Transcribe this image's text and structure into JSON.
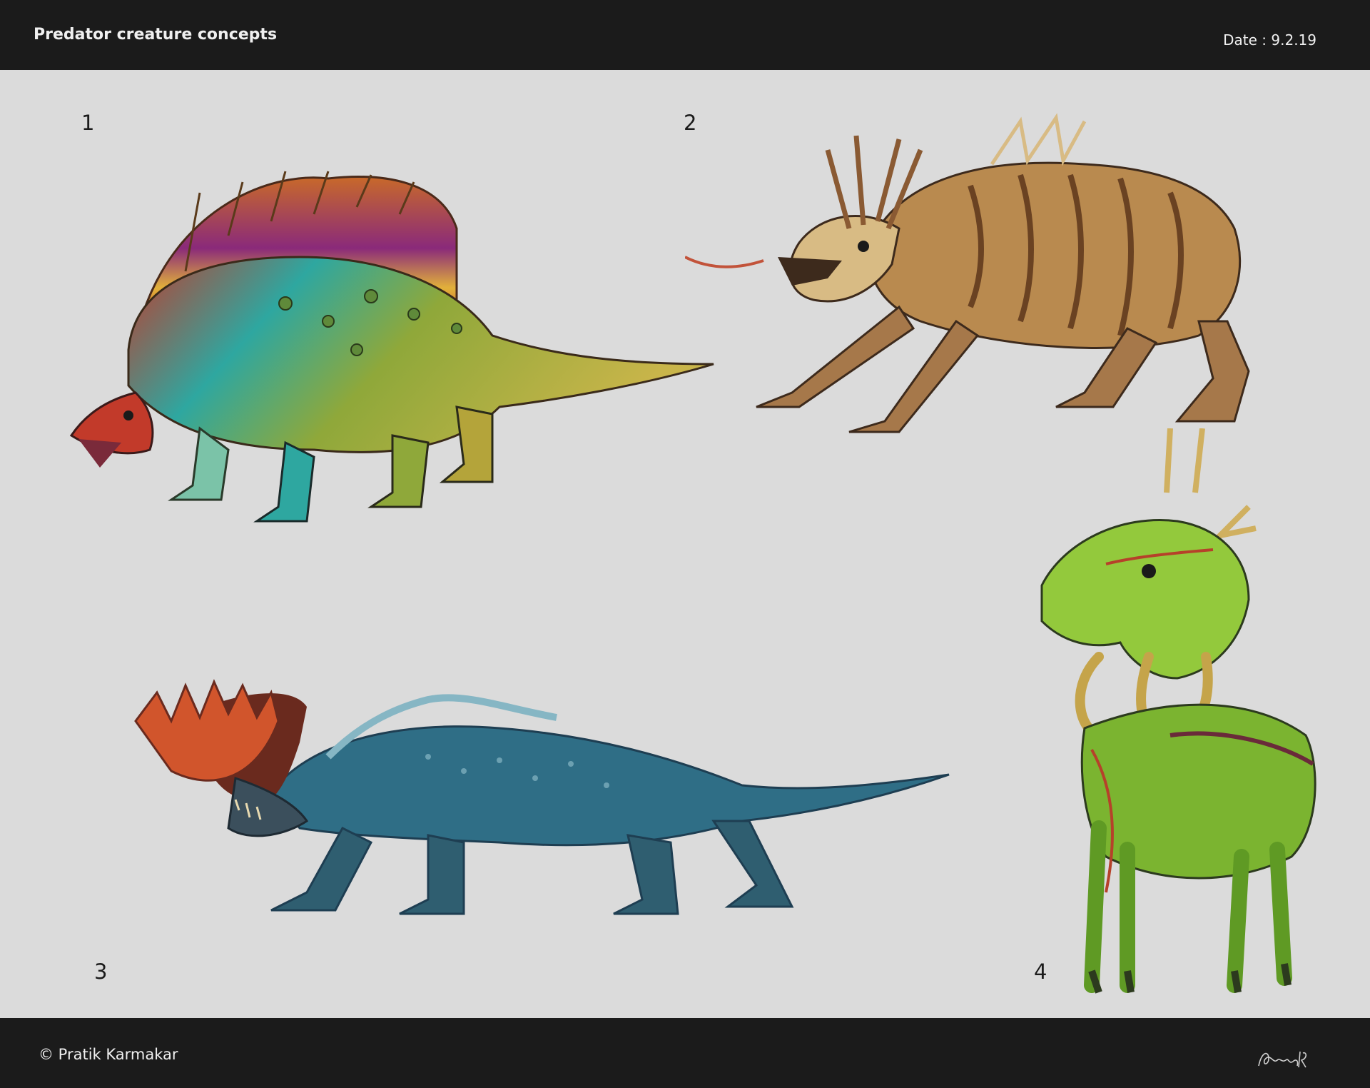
{
  "header": {
    "title": "Predator creature concepts",
    "date": "Date : 9.2.19"
  },
  "concepts": [
    {
      "number": "1",
      "palette": [
        "#c23a2a",
        "#e2b13a",
        "#8fa83a",
        "#2ea7a0",
        "#8a2a7a"
      ]
    },
    {
      "number": "2",
      "palette": [
        "#b98a4f",
        "#8a5a33",
        "#d8bb84",
        "#3d2a1c"
      ]
    },
    {
      "number": "3",
      "palette": [
        "#d1552c",
        "#2f6e86",
        "#1e3e52",
        "#86b6c4"
      ]
    },
    {
      "number": "4",
      "palette": [
        "#93c93c",
        "#5f9a24",
        "#b6412a",
        "#2c3a1e"
      ]
    }
  ],
  "footer": {
    "credit": "© Pratik Karmakar",
    "signature_text": "Pratik'19"
  }
}
